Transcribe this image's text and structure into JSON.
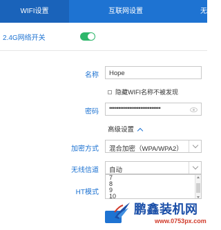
{
  "tabs": [
    {
      "label": "WIFI设置",
      "active": true
    },
    {
      "label": "互联网设置",
      "active": false
    },
    {
      "label": "无",
      "active": false
    }
  ],
  "wifi_switch": {
    "label": "2.4G网络开关",
    "on": true
  },
  "form": {
    "name_label": "名称",
    "name_value": "Hope",
    "hide_ssid_label": "隐藏WIFI名称不被发现",
    "password_label": "密码",
    "password_value": "••••••••••••••••••••••••••••",
    "advanced_label": "高级设置",
    "encryption_label": "加密方式",
    "encryption_value": "混合加密（WPA/WPA2）",
    "channel_label": "无线信道",
    "channel_value": "自动",
    "ht_mode_label": "HT模式"
  },
  "channel_options": [
    "7",
    "8",
    "9",
    "10"
  ],
  "watermark": {
    "title": "鹏鑫装机网",
    "url": "www.0753px.com"
  },
  "colors": {
    "accent": "#1e73d2",
    "tab_active": "#1a63ba",
    "switch_on": "#2eb76b",
    "watermark_blue": "#1b4fa8",
    "watermark_red": "#d13a2a"
  }
}
